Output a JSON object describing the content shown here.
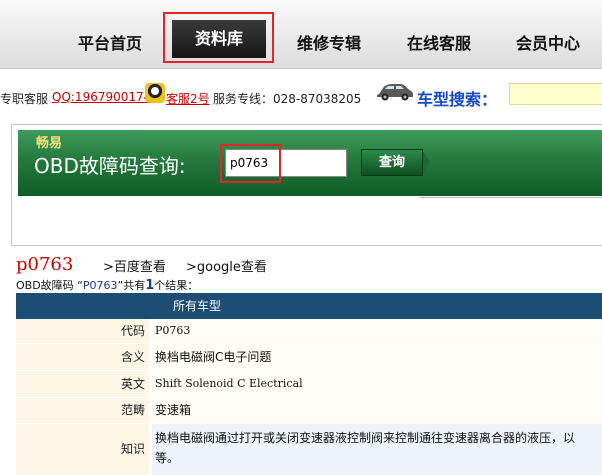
{
  "nav": {
    "items": [
      "平台首页",
      "资料库",
      "维修专辑",
      "在线客服",
      "会员中心"
    ]
  },
  "info_bar": {
    "prefix": "专职客服",
    "qq": "QQ:1967900174",
    "service2": "客服2号",
    "hotline": "服务专线：028-87038205",
    "car_search_label": "车型搜索："
  },
  "obd": {
    "small_label": "畅易",
    "title": "OBD故障码查询:",
    "input_value": "p0763",
    "query_button": "查询"
  },
  "result": {
    "code": "p0763",
    "baidu_link": ">百度查看",
    "google_link": ">google查看",
    "summary_prefix": "OBD故障码 “",
    "summary_code": "P0763",
    "summary_mid": "”共有",
    "summary_count": "1",
    "summary_suffix": "个结果：",
    "table_header": "所有车型",
    "rows": [
      {
        "label": "代码",
        "value": "P0763"
      },
      {
        "label": "含义",
        "value": "换档电磁阀C电子问题"
      },
      {
        "label": "英文",
        "value": "Shift Solenoid C Electrical"
      },
      {
        "label": "范畴",
        "value": "变速箱"
      },
      {
        "label": "知识",
        "value": "换档电磁阀通过打开或关闭变速器液控制阀来控制通往变速器离合器的液压，以",
        "value2": "等。"
      }
    ]
  },
  "colors": {
    "nav_active_bg": "#1c1c1c",
    "highlight_frame": "#e0262b",
    "banner_green": "#24793d",
    "table_header": "#1e4d73",
    "code_red": "#cc0000",
    "link_blue": "#1848c8"
  }
}
